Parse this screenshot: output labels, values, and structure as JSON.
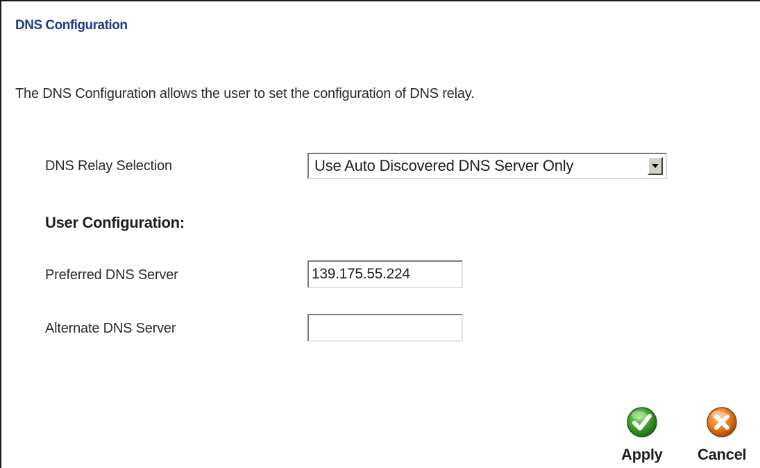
{
  "page": {
    "title": "DNS Configuration",
    "description": "The DNS Configuration allows the user to set the configuration of DNS relay."
  },
  "dns_relay": {
    "label": "DNS Relay Selection",
    "selected": "Use Auto Discovered DNS Server Only"
  },
  "user_config": {
    "heading": "User Configuration:",
    "preferred_label": "Preferred DNS Server",
    "preferred_value": "139.175.55.224",
    "alternate_label": "Alternate DNS Server",
    "alternate_value": ""
  },
  "actions": {
    "apply_label": "Apply",
    "cancel_label": "Cancel"
  },
  "colors": {
    "title": "#1f3c8c",
    "apply_icon": "#3a9c2a",
    "cancel_icon": "#e57a1e"
  },
  "icons": {
    "apply": "check-icon",
    "cancel": "cancel-x-icon",
    "dropdown": "chevron-down-icon"
  }
}
